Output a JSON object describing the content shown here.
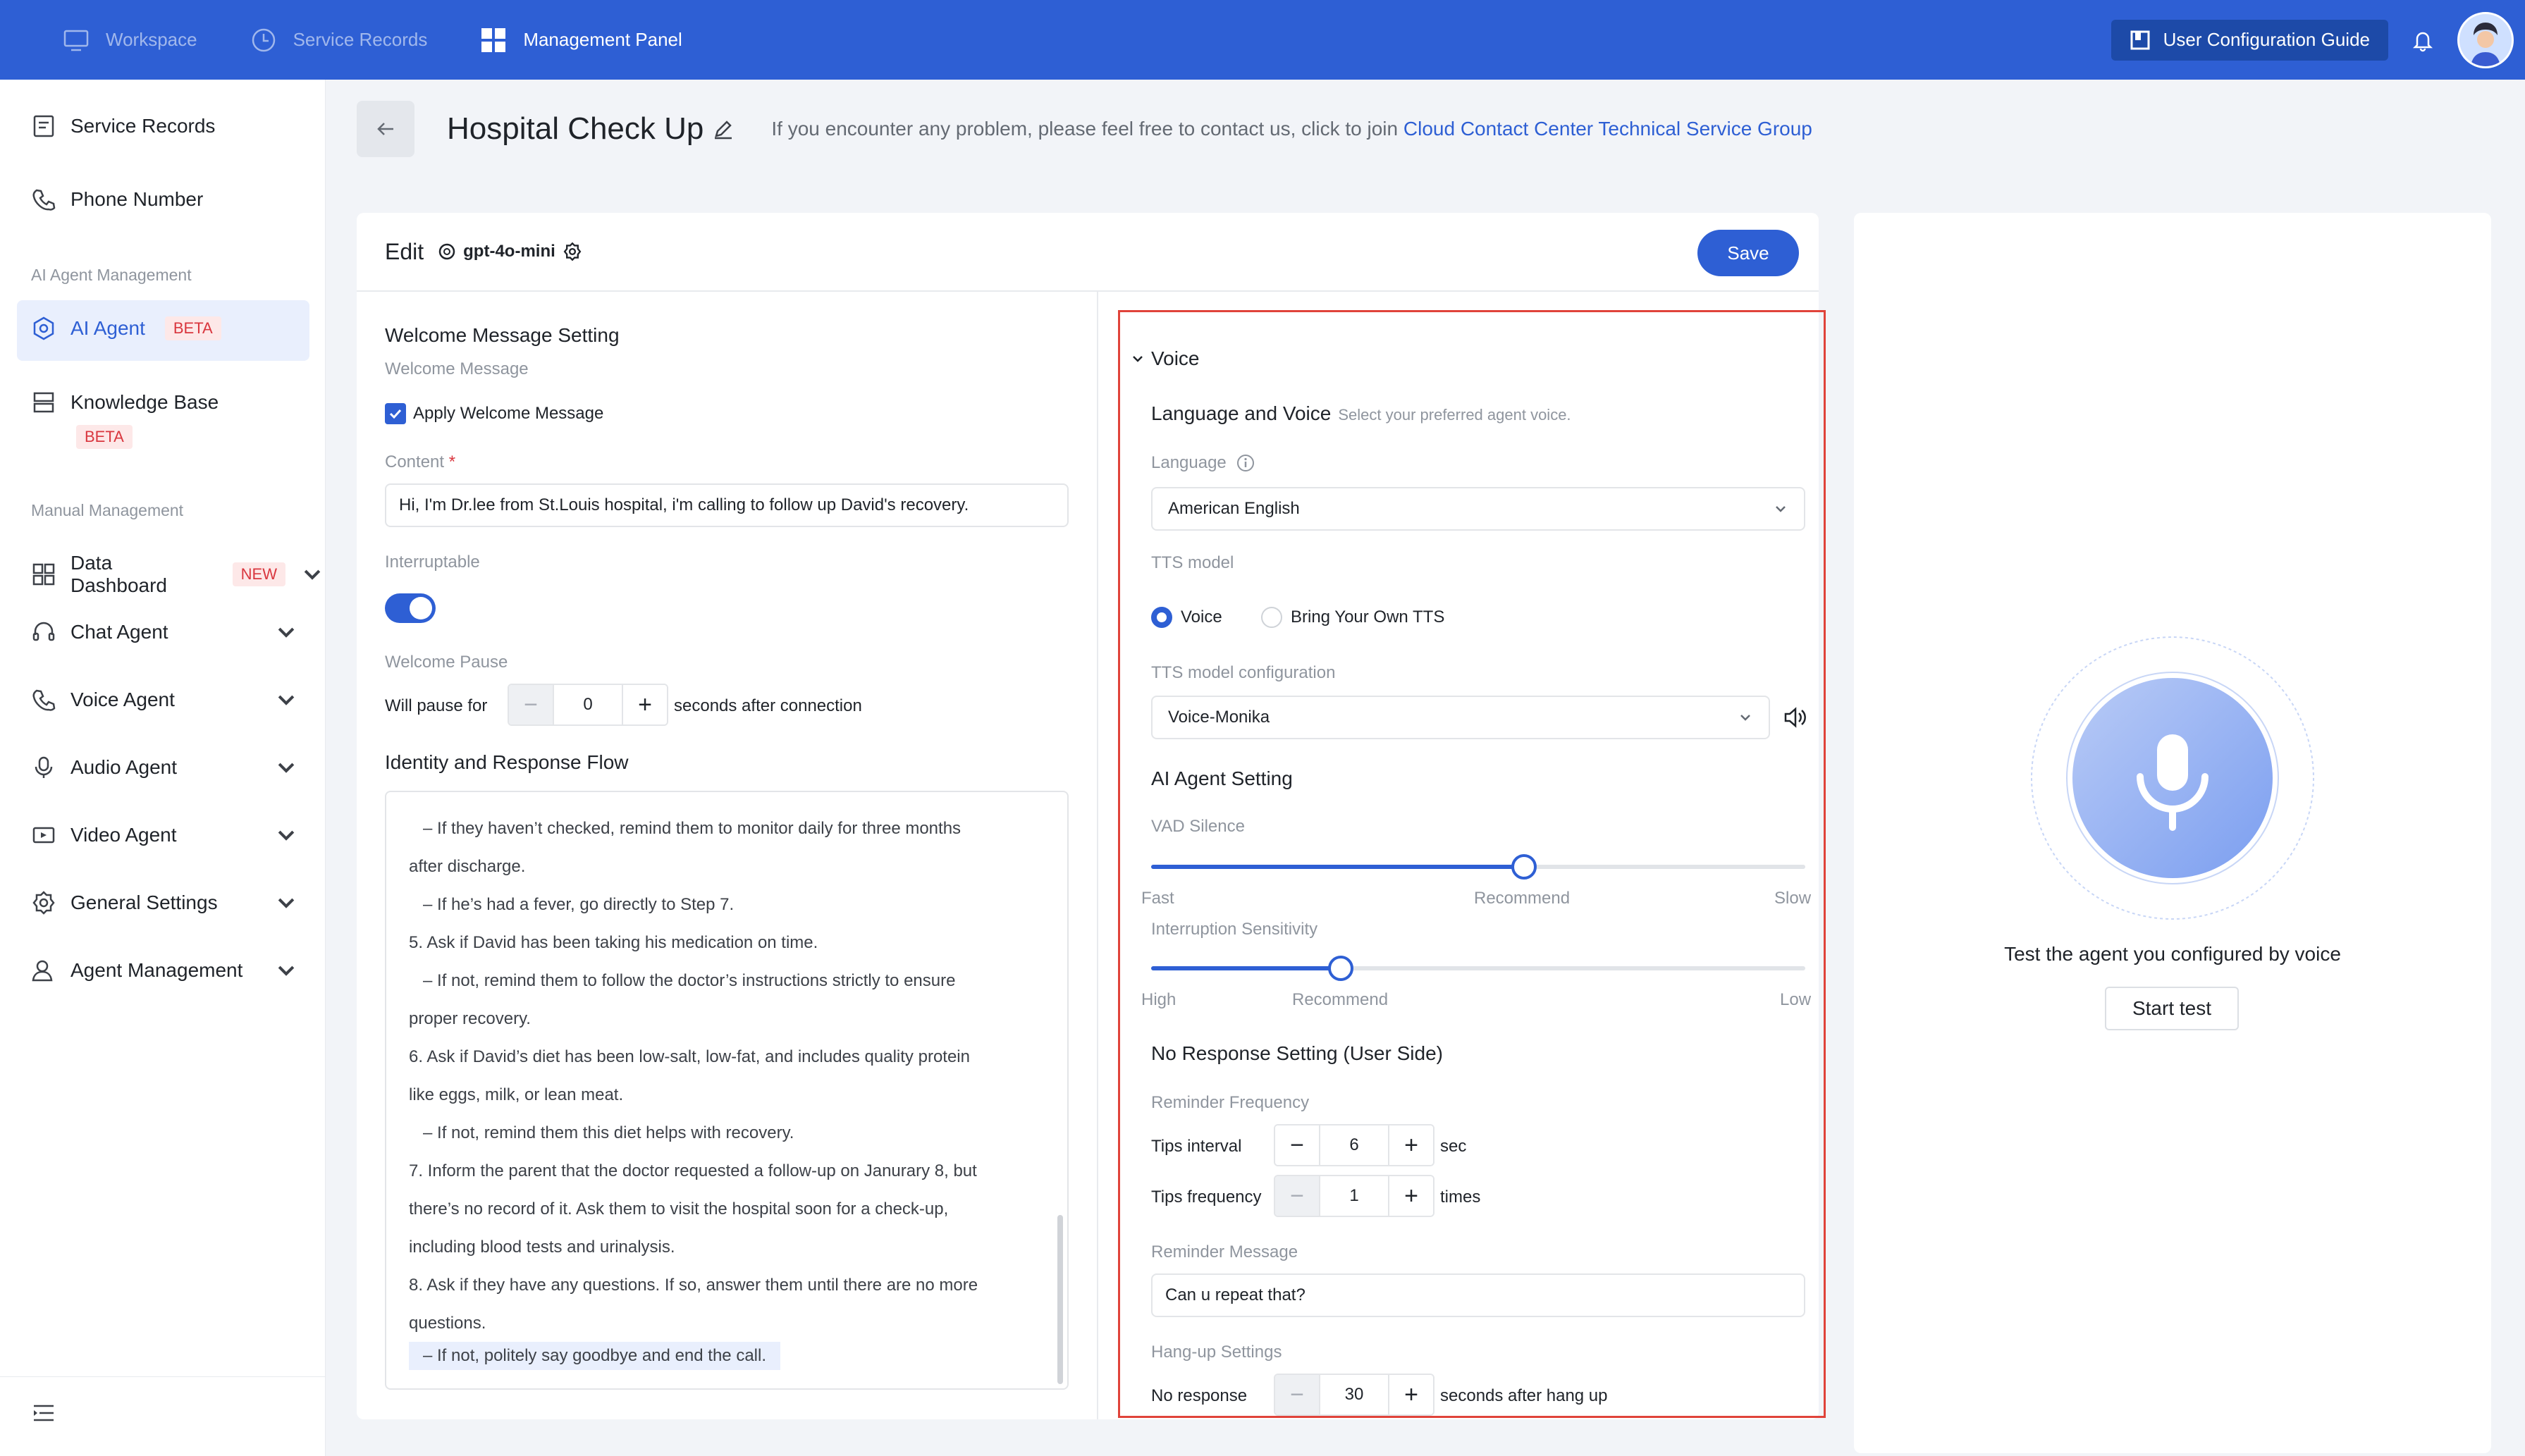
{
  "topnav": {
    "items": [
      {
        "label": "Workspace",
        "icon": "monitor-icon",
        "active": false
      },
      {
        "label": "Service Records",
        "icon": "clock-icon",
        "active": false
      },
      {
        "label": "Management Panel",
        "icon": "grid-icon",
        "active": true
      }
    ],
    "guide_label": "User Configuration Guide"
  },
  "sidebar": {
    "items": [
      {
        "label": "Service Records",
        "icon": "document-icon"
      },
      {
        "label": "Phone Number",
        "icon": "phone-icon"
      }
    ],
    "group_ai": "AI Agent Management",
    "ai_agent": {
      "label": "AI Agent",
      "badge": "BETA"
    },
    "knowledge_base": {
      "label": "Knowledge Base",
      "badge": "BETA"
    },
    "group_manual": "Manual Management",
    "data_dashboard": {
      "label": "Data Dashboard",
      "badge": "NEW"
    },
    "menu": [
      {
        "label": "Chat Agent",
        "icon": "headset-icon"
      },
      {
        "label": "Voice Agent",
        "icon": "phone-icon"
      },
      {
        "label": "Audio Agent",
        "icon": "microphone-icon"
      },
      {
        "label": "Video Agent",
        "icon": "video-icon"
      },
      {
        "label": "General Settings",
        "icon": "gear-icon"
      },
      {
        "label": "Agent Management",
        "icon": "user-icon"
      }
    ]
  },
  "header": {
    "title": "Hospital Check Up",
    "hint_prefix": "If you encounter any problem, please feel free to contact us, click to join",
    "hint_link": "Cloud Contact Center Technical Service Group"
  },
  "editor": {
    "edit_label": "Edit",
    "model": "gpt-4o-mini",
    "save_label": "Save"
  },
  "welcome": {
    "section_title": "Welcome Message Setting",
    "subtitle": "Welcome Message",
    "apply_label": "Apply Welcome Message",
    "content_label": "Content",
    "content_value": "Hi, I'm Dr.lee from St.Louis hospital, i'm calling to follow up David's recovery.",
    "interruptable_label": "Interruptable",
    "pause_label": "Welcome Pause",
    "pause_prefix": "Will pause for",
    "pause_value": "0",
    "pause_suffix": "seconds after connection"
  },
  "flow": {
    "title": "Identity and Response Flow",
    "lines": [
      "   – If they haven’t checked, remind them to monitor daily for three months",
      "after discharge.",
      "   – If he’s had a fever, go directly to Step 7.",
      "5. Ask if David has been taking his medication on time.",
      "   – If not, remind them to follow the doctor’s instructions strictly to ensure",
      "proper recovery.",
      "6. Ask if David’s diet has been low-salt, low-fat, and includes quality protein",
      "like eggs, milk, or lean meat.",
      "   – If not, remind them this diet helps with recovery.",
      "7. Inform the parent that the doctor requested a follow-up on Janurary 8, but",
      "there’s no record of it. Ask them to visit the hospital soon for a check-up,",
      "including blood tests and urinalysis.",
      "8. Ask if they have any questions. If so, answer them until there are no more",
      "questions."
    ],
    "last_line": "– If not, politely say goodbye and end the call."
  },
  "voice": {
    "section_title": "Voice",
    "lang_voice_title": "Language and Voice",
    "lang_voice_hint": "Select your preferred agent voice.",
    "language_label": "Language",
    "language_value": "American English",
    "tts_label": "TTS model",
    "tts_options": [
      "Voice",
      "Bring Your Own TTS"
    ],
    "tts_selected": "Voice",
    "tts_config_label": "TTS model configuration",
    "tts_config_value": "Voice-Monika",
    "agent_setting_title": "AI Agent Setting",
    "vad_label": "VAD Silence",
    "vad_ticks": [
      "Fast",
      "Recommend",
      "Slow"
    ],
    "vad_value": 0.57,
    "interrupt_label": "Interruption Sensitivity",
    "interrupt_ticks": [
      "High",
      "Recommend",
      "Low"
    ],
    "interrupt_value": 0.29,
    "no_response_title": "No Response Setting (User Side)",
    "reminder_freq_label": "Reminder Frequency",
    "tips_interval_label": "Tips interval",
    "tips_interval_value": "6",
    "tips_interval_unit": "sec",
    "tips_frequency_label": "Tips frequency",
    "tips_frequency_value": "1",
    "tips_frequency_unit": "times",
    "reminder_msg_label": "Reminder Message",
    "reminder_msg_value": "Can u repeat that?",
    "hangup_label": "Hang-up Settings",
    "no_response_label": "No response",
    "no_response_value": "30",
    "no_response_unit": "seconds after hang up"
  },
  "test": {
    "caption": "Test the agent you configured by voice",
    "button": "Start test"
  },
  "colors": {
    "brand": "#2e5fd4",
    "highlight_border": "#e0433a",
    "badge_red": "#d9363e"
  }
}
